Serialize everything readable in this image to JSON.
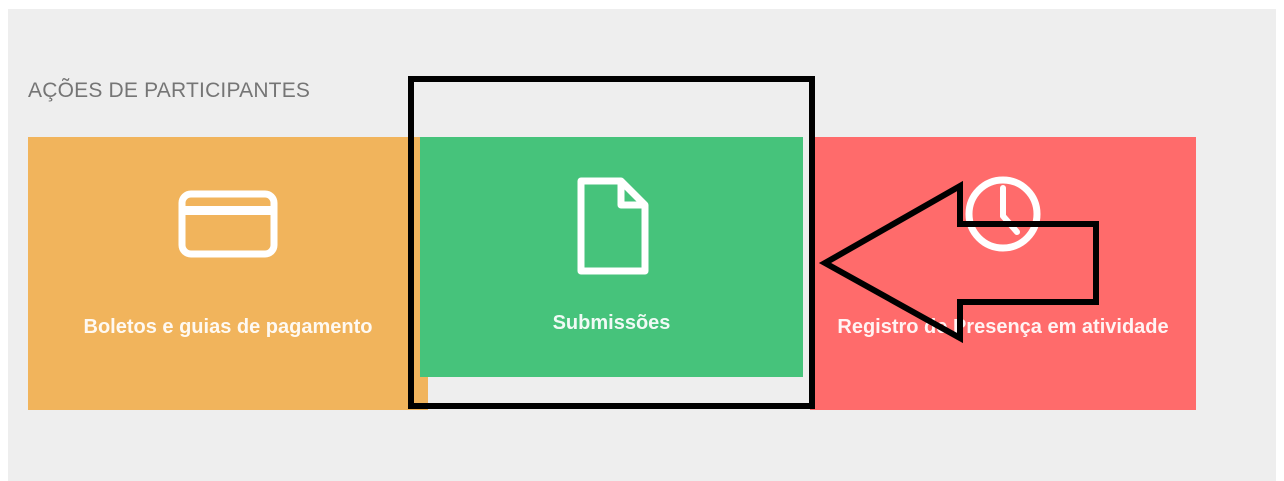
{
  "section": {
    "title": "AÇÕES DE PARTICIPANTES"
  },
  "tiles": [
    {
      "label": "Boletos e guias de pagamento",
      "icon": "credit-card-icon",
      "color": "#f1b45c"
    },
    {
      "label": "Submissões",
      "icon": "document-icon",
      "color": "#46c37b"
    },
    {
      "label": "Registro de Presença em atividade",
      "icon": "clock-icon",
      "color": "#ff6b6b"
    }
  ],
  "annotation": {
    "highlight_color": "#000000",
    "arrow_icon": "left-arrow-icon"
  }
}
